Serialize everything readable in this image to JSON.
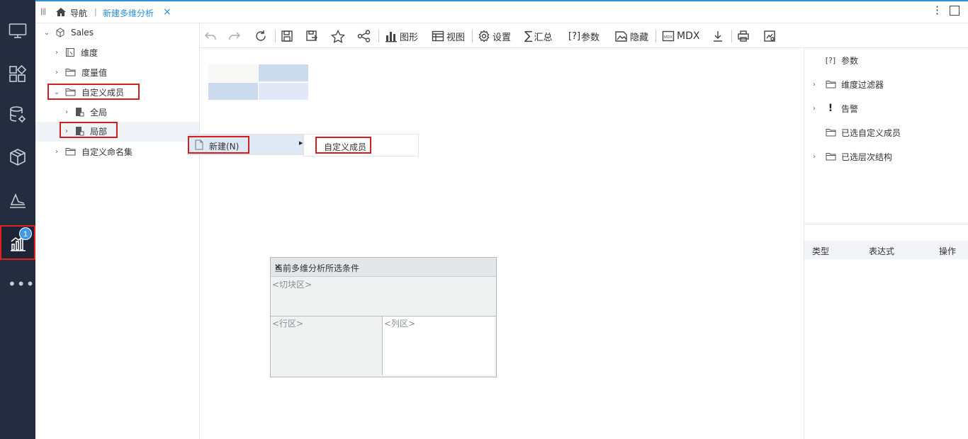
{
  "tabbar": {
    "home_label": "导航",
    "separator": "|",
    "active_tab": "新建多维分析",
    "close": "×"
  },
  "leftnav": {
    "badge": "1",
    "items": [
      "monitor-icon",
      "dashboard-icon",
      "database-settings-icon",
      "cube-icon",
      "report-icon",
      "analysis-chart-icon",
      "more-icon"
    ]
  },
  "tree": {
    "root": "Sales",
    "items": [
      {
        "label": "维度",
        "icon": "dimension-icon"
      },
      {
        "label": "度量值",
        "icon": "folder-icon"
      },
      {
        "label": "自定义成员",
        "icon": "folder-icon"
      },
      {
        "label": "全局",
        "icon": "scope-icon"
      },
      {
        "label": "局部",
        "icon": "scope-icon"
      },
      {
        "label": "自定义命名集",
        "icon": "folder-icon"
      }
    ]
  },
  "toolbar": {
    "chart": "图形",
    "view": "视图",
    "settings": "设置",
    "summary": "汇总",
    "params_prefix": "[?]",
    "params": "参数",
    "hide": "隐藏",
    "mdx": "MDX"
  },
  "context_menu": {
    "new_item": "新建(N)",
    "arrow": "▶",
    "sub_item": "自定义成员"
  },
  "right_panel": {
    "items": [
      {
        "label": "参数",
        "icon": "[?]"
      },
      {
        "label": "维度过滤器",
        "icon": "folder-icon"
      },
      {
        "label": "告警",
        "icon": "!"
      },
      {
        "label": "已选自定义成员",
        "icon": "folder-icon"
      },
      {
        "label": "已选层次结构",
        "icon": "folder-icon"
      }
    ],
    "table_headers": [
      "类型",
      "表达式",
      "操作"
    ]
  },
  "conditions": {
    "title": "当前多维分析所选条件",
    "close": "×",
    "slice": "<切块区>",
    "rows": "<行区>",
    "cols": "<列区>"
  }
}
